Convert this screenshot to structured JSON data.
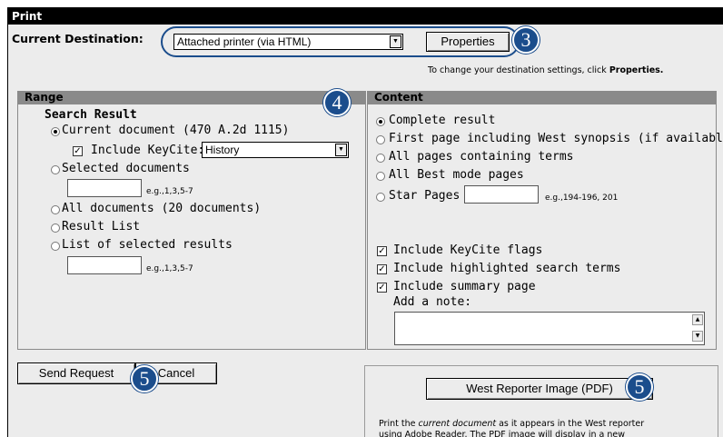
{
  "dialog": {
    "title": "Print",
    "destination_label": "Current Destination:",
    "destination_value": "Attached printer (via HTML)",
    "properties_label": "Properties",
    "hint_prefix": "To change your destination settings, click ",
    "hint_bold": "Properties."
  },
  "badges": {
    "b3": "3",
    "b4": "4",
    "b5a": "5",
    "b5b": "5"
  },
  "range": {
    "header": "Range",
    "section_title": "Search Result",
    "current_document": "Current document (470 A.2d 1115)",
    "include_keycite": "Include KeyCite:",
    "keycite_value": "History",
    "selected_documents": "Selected documents",
    "example": "e.g.,1,3,5-7",
    "all_documents": "All documents (20 documents)",
    "result_list": "Result List",
    "list_selected": "List of selected results",
    "example2": "e.g.,1,3,5-7"
  },
  "content": {
    "header": "Content",
    "complete_result": "Complete result",
    "first_page": "First page including West synopsis (if available)",
    "all_pages_terms": "All pages containing terms",
    "all_best_mode": "All Best mode pages",
    "star_pages": "Star Pages",
    "star_example": "e.g.,194-196, 201",
    "flags": "Include KeyCite flags",
    "highlighted": "Include highlighted search terms",
    "summary": "Include summary page",
    "add_note": "Add a note:"
  },
  "actions": {
    "send_request": "Send Request",
    "cancel": "Cancel",
    "west_reporter": "West Reporter Image (PDF)",
    "desc_prefix": "Print the ",
    "desc_italic": "current document",
    "desc_suffix": " as it appears in the West reporter",
    "desc_line2": "using Adobe Reader. The PDF image will display in a new"
  },
  "colors": {
    "badge": "#1b4d8c",
    "title_bar": "#000000",
    "section_header": "#8a8a8a",
    "oval": "#1b4d8c"
  }
}
